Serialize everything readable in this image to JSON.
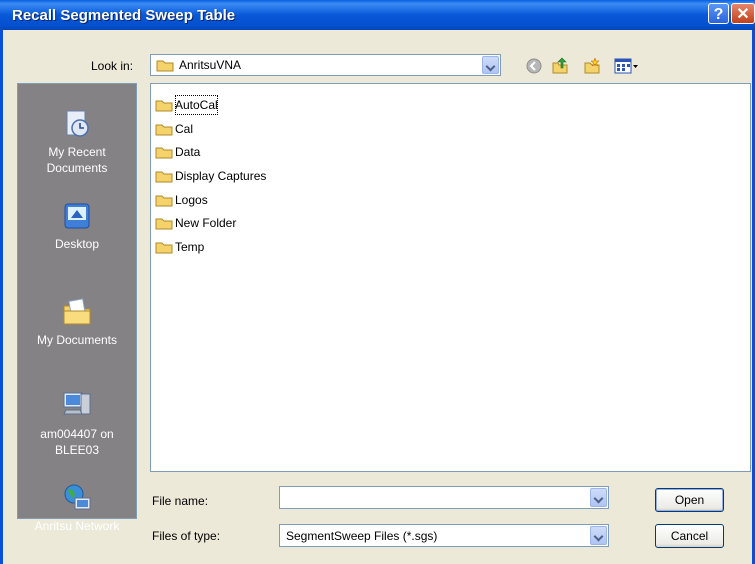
{
  "window": {
    "title": "Recall Segmented Sweep Table"
  },
  "look_in": {
    "label": "Look in:",
    "value": "AnritsuVNA"
  },
  "places": [
    {
      "label": "My Recent Documents"
    },
    {
      "label": "Desktop"
    },
    {
      "label": "My Documents"
    },
    {
      "label": "am004407 on BLEE03"
    },
    {
      "label": "Anritsu Network"
    }
  ],
  "files": [
    "AutoCal",
    "Cal",
    "Data",
    "Display Captures",
    "Logos",
    "New Folder",
    "Temp"
  ],
  "file_name": {
    "label": "File name:",
    "value": ""
  },
  "file_type": {
    "label": "Files of type:",
    "value": "SegmentSweep Files (*.sgs)"
  },
  "buttons": {
    "open": "Open",
    "cancel": "Cancel"
  },
  "colors": {
    "title_bar": "#0a5fe0",
    "places_bg": "#848284",
    "folder": "#f5d36b"
  }
}
